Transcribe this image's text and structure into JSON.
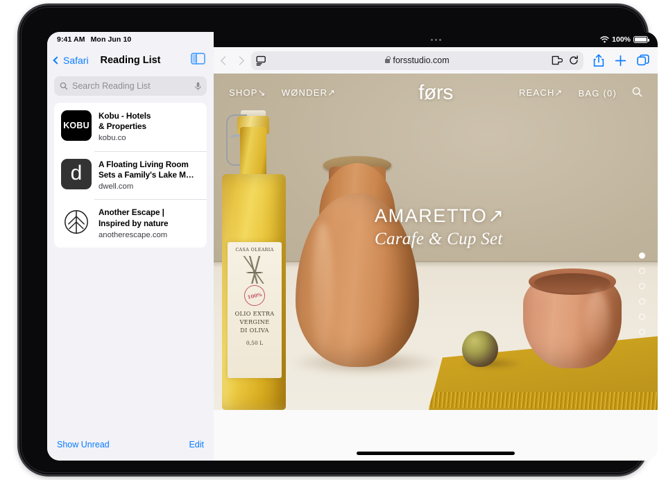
{
  "status_bar": {
    "time": "9:41 AM",
    "date": "Mon Jun 10",
    "battery_percent": "100%",
    "wifi_icon": "wifi-icon",
    "battery_icon": "battery-icon"
  },
  "sidebar": {
    "back_label": "Safari",
    "title": "Reading List",
    "toggle_icon": "sidebar-toggle-icon",
    "search": {
      "placeholder": "Search Reading List",
      "value": "",
      "search_icon": "search-icon",
      "mic_icon": "microphone-icon"
    },
    "items": [
      {
        "title": "Kobu - Hotels\n& Properties",
        "title_line1": "Kobu - Hotels",
        "title_line2": "& Properties",
        "url": "kobu.co",
        "favicon_type": "kobu-wordmark",
        "favicon_text": "KOBU"
      },
      {
        "title_line1": "A Floating Living Room",
        "title_line2": "Sets a Family's Lake M…",
        "url": "dwell.com",
        "favicon_type": "dwell-letter",
        "favicon_text": "d"
      },
      {
        "title_line1": "Another Escape |",
        "title_line2": "Inspired by nature",
        "url": "anotherescape.com",
        "favicon_type": "leaf-circle-icon",
        "favicon_text": ""
      }
    ],
    "footer": {
      "show_unread": "Show Unread",
      "edit": "Edit"
    }
  },
  "browser": {
    "back_icon": "chevron-left-icon",
    "forward_icon": "chevron-right-icon",
    "reader_icon": "reader-view-icon",
    "lock_icon": "lock-icon",
    "url": "forsstudio.com",
    "extension_icon": "extension-icon",
    "reload_icon": "reload-icon",
    "share_icon": "share-icon",
    "new_tab_icon": "plus-icon",
    "tabs_icon": "tab-overview-icon",
    "grabber_icon": "window-grabber-icon"
  },
  "website": {
    "brand": "førs",
    "nav_left": [
      {
        "label": "SHOP",
        "arrow": "↘"
      },
      {
        "label": "WØNDER",
        "arrow": "↗"
      }
    ],
    "nav_right": [
      {
        "label": "REACH",
        "arrow": "↗"
      },
      {
        "label": "BAG (0)",
        "arrow": ""
      }
    ],
    "search_icon": "search-icon",
    "hero": {
      "title": "AMARETTO",
      "title_arrow": "↗",
      "subtitle": "Carafe & Cup Set"
    },
    "carousel": {
      "total": 6,
      "active_index": 0
    },
    "bottle_label": {
      "line1": "CASA OLEARIA",
      "stamp": "100%",
      "line2": "OLIO EXTRA\nVERGINE\nDI OLIVA",
      "line2_a": "OLIO EXTRA",
      "line2_b": "VERGINE",
      "line2_c": "DI OLIVA",
      "line3": "0,50 L"
    }
  },
  "colors": {
    "accent_blue": "#0a7cff",
    "sidebar_bg": "#f2f2f7",
    "hero_bg": "#bfb39c",
    "terracotta": "#d69561",
    "cloth_yellow": "#caa01f"
  }
}
